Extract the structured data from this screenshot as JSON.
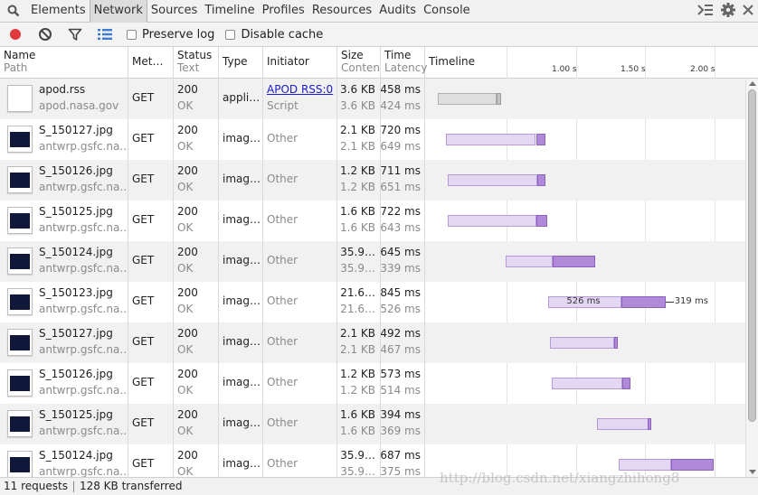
{
  "tabs": [
    {
      "label": "Elements",
      "active": false
    },
    {
      "label": "Network",
      "active": true
    },
    {
      "label": "Sources",
      "active": false
    },
    {
      "label": "Timeline",
      "active": false
    },
    {
      "label": "Profiles",
      "active": false
    },
    {
      "label": "Resources",
      "active": false
    },
    {
      "label": "Audits",
      "active": false
    },
    {
      "label": "Console",
      "active": false
    }
  ],
  "toolbar": {
    "record_icon": "record-icon",
    "clear_icon": "clear-icon",
    "filter_icon": "filter-icon",
    "view_icon": "list-view-icon",
    "preserve_log": "Preserve log",
    "disable_cache": "Disable cache"
  },
  "columns": {
    "name": "Name",
    "path": "Path",
    "method": "Met…",
    "status": "Status",
    "text": "Text",
    "type": "Type",
    "initiator": "Initiator",
    "size": "Size",
    "content": "Conten",
    "time": "Time",
    "latency": "Latency",
    "timeline": "Timeline",
    "ticks": [
      "1.00 s",
      "1.50 s",
      "2.00 s"
    ]
  },
  "requests": [
    {
      "name": "apod.rss",
      "domain": "apod.nasa.gov",
      "method": "GET",
      "status": "200",
      "status_text": "OK",
      "type": "appli…",
      "initiator": "APOD RSS:0",
      "initiator_sub": "Script",
      "initiator_link": true,
      "size": "3.6 KB",
      "content": "3.6 KB",
      "time": "458 ms",
      "latency": "424 ms",
      "thumb": "document",
      "timing": {
        "start_s": 0.0,
        "latency_s": 0.424,
        "end_s": 0.458
      }
    },
    {
      "name": "S_150127.jpg",
      "domain": "antwrp.gsfc.na…",
      "method": "GET",
      "status": "200",
      "status_text": "OK",
      "type": "imag…",
      "initiator": "Other",
      "initiator_sub": "",
      "initiator_link": false,
      "size": "2.1 KB",
      "content": "2.1 KB",
      "time": "720 ms",
      "latency": "649 ms",
      "thumb": "image",
      "timing": {
        "start_s": 0.06,
        "latency_s": 0.709,
        "end_s": 0.78
      }
    },
    {
      "name": "S_150126.jpg",
      "domain": "antwrp.gsfc.na…",
      "method": "GET",
      "status": "200",
      "status_text": "OK",
      "type": "imag…",
      "initiator": "Other",
      "initiator_sub": "",
      "initiator_link": false,
      "size": "1.2 KB",
      "content": "1.2 KB",
      "time": "711 ms",
      "latency": "651 ms",
      "thumb": "image",
      "timing": {
        "start_s": 0.07,
        "latency_s": 0.721,
        "end_s": 0.781
      }
    },
    {
      "name": "S_150125.jpg",
      "domain": "antwrp.gsfc.na…",
      "method": "GET",
      "status": "200",
      "status_text": "OK",
      "type": "imag…",
      "initiator": "Other",
      "initiator_sub": "",
      "initiator_link": false,
      "size": "1.6 KB",
      "content": "1.6 KB",
      "time": "722 ms",
      "latency": "643 ms",
      "thumb": "image",
      "timing": {
        "start_s": 0.07,
        "latency_s": 0.713,
        "end_s": 0.792
      }
    },
    {
      "name": "S_150124.jpg",
      "domain": "antwrp.gsfc.na…",
      "method": "GET",
      "status": "200",
      "status_text": "OK",
      "type": "imag…",
      "initiator": "Other",
      "initiator_sub": "",
      "initiator_link": false,
      "size": "35.9…",
      "content": "35.9…",
      "time": "645 ms",
      "latency": "339 ms",
      "thumb": "image",
      "timing": {
        "start_s": 0.49,
        "latency_s": 0.829,
        "end_s": 1.135
      }
    },
    {
      "name": "S_150123.jpg",
      "domain": "antwrp.gsfc.na…",
      "method": "GET",
      "status": "200",
      "status_text": "OK",
      "type": "imag…",
      "initiator": "Other",
      "initiator_sub": "",
      "initiator_link": false,
      "size": "21.6…",
      "content": "21.6…",
      "time": "845 ms",
      "latency": "526 ms",
      "thumb": "image",
      "timing": {
        "start_s": 0.8,
        "latency_s": 1.326,
        "end_s": 1.645
      },
      "labels": {
        "left": "526 ms",
        "right": "319 ms"
      }
    },
    {
      "name": "S_150127.jpg",
      "domain": "antwrp.gsfc.na…",
      "method": "GET",
      "status": "200",
      "status_text": "OK",
      "type": "imag…",
      "initiator": "Other",
      "initiator_sub": "",
      "initiator_link": false,
      "size": "2.1 KB",
      "content": "2.1 KB",
      "time": "492 ms",
      "latency": "467 ms",
      "thumb": "image",
      "timing": {
        "start_s": 0.81,
        "latency_s": 1.277,
        "end_s": 1.302
      }
    },
    {
      "name": "S_150126.jpg",
      "domain": "antwrp.gsfc.na…",
      "method": "GET",
      "status": "200",
      "status_text": "OK",
      "type": "imag…",
      "initiator": "Other",
      "initiator_sub": "",
      "initiator_link": false,
      "size": "1.2 KB",
      "content": "1.2 KB",
      "time": "573 ms",
      "latency": "514 ms",
      "thumb": "image",
      "timing": {
        "start_s": 0.82,
        "latency_s": 1.334,
        "end_s": 1.393
      }
    },
    {
      "name": "S_150125.jpg",
      "domain": "antwrp.gsfc.na…",
      "method": "GET",
      "status": "200",
      "status_text": "OK",
      "type": "imag…",
      "initiator": "Other",
      "initiator_sub": "",
      "initiator_link": false,
      "size": "1.6 KB",
      "content": "1.6 KB",
      "time": "394 ms",
      "latency": "369 ms",
      "thumb": "image",
      "timing": {
        "start_s": 1.15,
        "latency_s": 1.519,
        "end_s": 1.544
      }
    },
    {
      "name": "S_150124.jpg",
      "domain": "antwrp.gsfc.na…",
      "method": "GET",
      "status": "200",
      "status_text": "OK",
      "type": "imag…",
      "initiator": "Other",
      "initiator_sub": "",
      "initiator_link": false,
      "size": "35.9…",
      "content": "35.9…",
      "time": "687 ms",
      "latency": "375 ms",
      "thumb": "image",
      "timing": {
        "start_s": 1.31,
        "latency_s": 1.685,
        "end_s": 1.997
      }
    }
  ],
  "status": {
    "requests": "11 requests",
    "transferred": "128 KB transferred"
  },
  "watermark": "http://blog.csdn.net/xiangzhihong8",
  "colors": {
    "record": "#e0383d",
    "link": "#1a1acf",
    "bar_wait": "#e3d7f3",
    "bar_receive": "#b08ad9"
  }
}
